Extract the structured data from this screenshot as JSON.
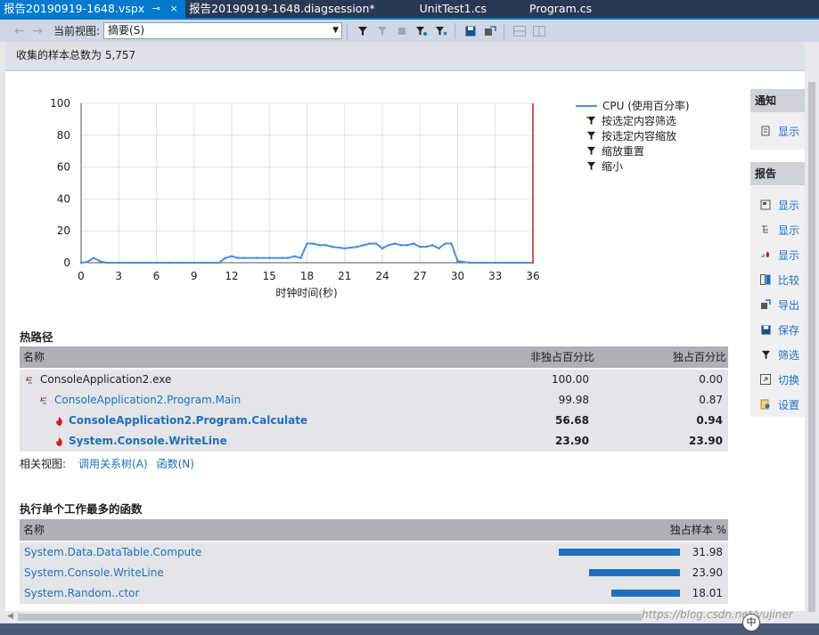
{
  "tabs": [
    {
      "label": "报告20190919-1648.vspx",
      "active": true,
      "pin": "⊸",
      "close": "×"
    },
    {
      "label": "报告20190919-1648.diagsession*",
      "active": false
    },
    {
      "label": "UnitTest1.cs",
      "active": false
    },
    {
      "label": "Program.cs",
      "active": false
    }
  ],
  "toolbar": {
    "back_icon": "←",
    "forward_icon": "→",
    "view_label": "当前视图:",
    "view_value": "摘要(S)"
  },
  "info": {
    "samples_text": "收集的样本总数为 5,757"
  },
  "chart_data": {
    "type": "line",
    "xlabel": "时钟时间(秒)",
    "ylabel": "",
    "xlim": [
      0,
      36
    ],
    "ylim": [
      0,
      100
    ],
    "x_ticks": [
      0,
      3,
      6,
      9,
      12,
      15,
      18,
      21,
      24,
      27,
      30,
      33,
      36
    ],
    "y_ticks": [
      0,
      20,
      40,
      60,
      80,
      100
    ],
    "grid": true,
    "legend_position": "right",
    "series": [
      {
        "name": "CPU (使用百分率)",
        "color": "#4a90d9",
        "x": [
          0,
          0.5,
          1,
          1.5,
          2,
          3,
          4,
          5,
          6,
          7,
          8,
          9,
          10,
          11,
          11.5,
          12,
          12.5,
          13,
          14,
          15,
          16,
          16.5,
          17,
          17.5,
          18,
          18.5,
          19,
          19.5,
          20,
          21,
          22,
          22.5,
          23,
          23.5,
          24,
          24.5,
          25,
          25.5,
          26,
          26.5,
          27,
          27.5,
          28,
          28.5,
          29,
          29.5,
          30,
          31,
          32,
          33,
          34,
          35,
          36
        ],
        "values": [
          0,
          0.5,
          3,
          1,
          0,
          0,
          0,
          0,
          0,
          0,
          0,
          0,
          0,
          0,
          3,
          4,
          3,
          3,
          3,
          3,
          3,
          3,
          4,
          3,
          12,
          12,
          11,
          11,
          10,
          9,
          10,
          11,
          12,
          12,
          9,
          11,
          12,
          11,
          11,
          12,
          10,
          10,
          11,
          9,
          12,
          12,
          1,
          0,
          0,
          0,
          0,
          0,
          0
        ]
      }
    ],
    "marker_x": 36,
    "marker_color": "#d11b1b"
  },
  "legend": {
    "cpu_label": "CPU (使用百分率)",
    "commands": [
      "按选定内容筛选",
      "按选定内容缩放",
      "缩放重置",
      "缩小"
    ]
  },
  "right_panel": {
    "notify_title": "通知",
    "notify_items": [
      "显示"
    ],
    "report_title": "报告",
    "report_items": [
      "显示",
      "显示",
      "显示",
      "比较",
      "导出",
      "保存",
      "筛选",
      "切换",
      "设置"
    ]
  },
  "hot_path": {
    "title": "热路径",
    "col_name": "名称",
    "col_inclusive": "非独占百分比",
    "col_exclusive": "独占百分比",
    "rows": [
      {
        "name": "ConsoleApplication2.exe",
        "inclusive": "100.00",
        "exclusive": "0.00"
      },
      {
        "name": "ConsoleApplication2.Program.Main",
        "inclusive": "99.98",
        "exclusive": "0.87"
      },
      {
        "name": "ConsoleApplication2.Program.Calculate",
        "inclusive": "56.68",
        "exclusive": "0.94"
      },
      {
        "name": "System.Console.WriteLine",
        "inclusive": "23.90",
        "exclusive": "23.90"
      }
    ]
  },
  "related": {
    "label": "相关视图:",
    "call_tree": "调用关系树(A)",
    "functions": "函数(N)"
  },
  "top_functions": {
    "title": "执行单个工作最多的函数",
    "col_name": "名称",
    "col_exclusive": "独占样本 %",
    "rows": [
      {
        "name": "System.Data.DataTable.Compute",
        "value": "31.98",
        "fraction": 0.3198
      },
      {
        "name": "System.Console.WriteLine",
        "value": "23.90",
        "fraction": 0.239
      },
      {
        "name": "System.Random..ctor",
        "value": "18.01",
        "fraction": 0.1801
      }
    ]
  },
  "watermark": "https://blog.csdn.net/vujiner",
  "ime": "中"
}
